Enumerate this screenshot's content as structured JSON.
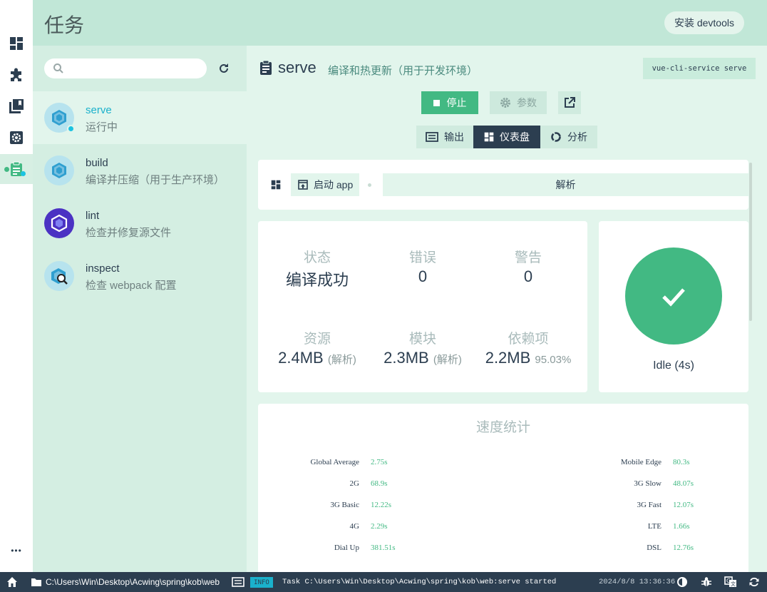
{
  "header": {
    "title": "任务",
    "devtools_label": "安装 devtools"
  },
  "rail": {
    "items": [
      "dashboard-icon",
      "plugins-icon",
      "dependencies-icon",
      "configuration-icon",
      "tasks-icon"
    ],
    "more": "•••"
  },
  "search": {
    "placeholder": "",
    "value": ""
  },
  "tasks": [
    {
      "name": "serve",
      "description": "运行中",
      "icon": "vue-cube-icon",
      "status": "running"
    },
    {
      "name": "build",
      "description": "编译并压缩（用于生产环境）",
      "icon": "vue-cube-icon"
    },
    {
      "name": "lint",
      "description": "检查并修复源文件",
      "icon": "eslint-icon"
    },
    {
      "name": "inspect",
      "description": "检查 webpack 配置",
      "icon": "inspect-icon"
    }
  ],
  "detail": {
    "name": "serve",
    "description": "编译和热更新（用于开发环境）",
    "command": "vue-cli-service serve",
    "stop_label": "停止",
    "params_label": "参数",
    "tabs": [
      "输出",
      "仪表盘",
      "分析"
    ],
    "active_tab": "仪表盘",
    "toolbar": {
      "launch_label": "启动 app",
      "analyze_label": "解析"
    },
    "stats": {
      "status_label": "状态",
      "status_value": "编译成功",
      "errors_label": "错误",
      "errors_value": "0",
      "warnings_label": "警告",
      "warnings_value": "0",
      "assets_label": "资源",
      "assets_value": "2.4MB",
      "assets_extra": "(解析)",
      "modules_label": "模块",
      "modules_value": "2.3MB",
      "modules_extra": "(解析)",
      "deps_label": "依赖项",
      "deps_value": "2.2MB",
      "deps_extra": "95.03%"
    },
    "status": {
      "text": "Idle (4s)",
      "color": "#42b983"
    },
    "speed": {
      "title": "速度统计",
      "left": [
        {
          "name": "Global Average",
          "value": "2.75s"
        },
        {
          "name": "2G",
          "value": "68.9s"
        },
        {
          "name": "3G Basic",
          "value": "12.22s"
        },
        {
          "name": "4G",
          "value": "2.29s"
        },
        {
          "name": "Dial Up",
          "value": "381.51s"
        }
      ],
      "right": [
        {
          "name": "Mobile Edge",
          "value": "80.3s"
        },
        {
          "name": "3G Slow",
          "value": "48.07s"
        },
        {
          "name": "3G Fast",
          "value": "12.07s"
        },
        {
          "name": "LTE",
          "value": "1.66s"
        },
        {
          "name": "DSL",
          "value": "12.76s"
        }
      ]
    }
  },
  "statusbar": {
    "path": "C:\\Users\\Win\\Desktop\\Acwing\\spring\\kob\\web",
    "badge": "INFO",
    "message": "Task C:\\Users\\Win\\Desktop\\Acwing\\spring\\kob\\web:serve started",
    "time": "2024/8/8  13:36:36"
  },
  "colors": {
    "accent": "#42b983",
    "dark": "#2c3e50",
    "info": "#1ab1cc",
    "header_bg": "#c1e7d7"
  }
}
